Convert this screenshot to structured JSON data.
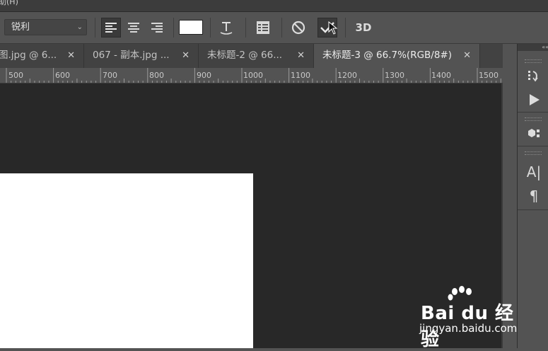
{
  "menubar": {
    "partial_text": "助(H)"
  },
  "options_bar": {
    "antialias_value": "锐利",
    "antialias_icon": "chevron-down-icon",
    "align_buttons": [
      "align-left-icon",
      "align-center-icon",
      "align-right-icon"
    ],
    "text_color": "#ffffff",
    "buttons": [
      "warp-text-icon",
      "character-paragraph-panel-icon",
      "cancel-icon",
      "commit-checkmark-icon"
    ],
    "three_d_label": "3D"
  },
  "tabs": [
    {
      "label": "图.jpg @ 6...",
      "active": false
    },
    {
      "label": "067 - 副本.jpg ...",
      "active": false
    },
    {
      "label": "未标题-2 @ 66...",
      "active": false
    },
    {
      "label": "未标题-3 @ 66.7%(RGB/8#)",
      "active": true
    }
  ],
  "tab_close_glyph": "✕",
  "ruler": {
    "labels": [
      "500",
      "600",
      "700",
      "800",
      "900",
      "1000",
      "1100",
      "1200",
      "1300",
      "1400",
      "1500"
    ]
  },
  "right_panel": {
    "collapse_glyph": "««",
    "icons": [
      "history-icon",
      "play-actions-icon",
      "3d-properties-icon",
      "character-icon",
      "paragraph-icon"
    ],
    "char_label": "A|",
    "para_label": "¶"
  },
  "watermark": {
    "brand": "Bai du 经验",
    "url": "jingyan.baidu.com"
  },
  "colors": {
    "workspace": "#282828",
    "panel": "#535353",
    "tab_inactive": "#424242",
    "document": "#ffffff"
  }
}
